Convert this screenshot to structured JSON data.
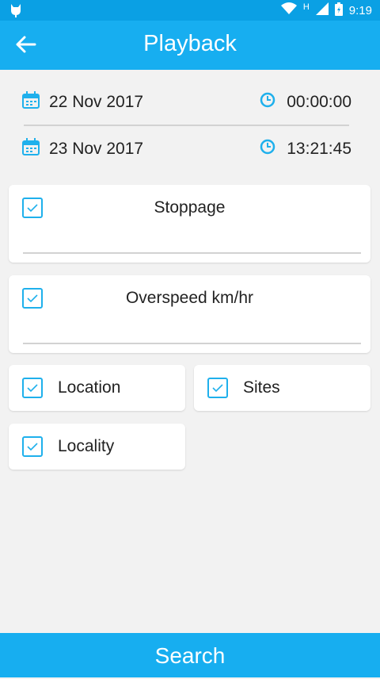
{
  "status_bar": {
    "network": "H",
    "time": "9:19"
  },
  "header": {
    "title": "Playback"
  },
  "from": {
    "date": "22 Nov 2017",
    "time": "00:00:00"
  },
  "to": {
    "date": "23 Nov 2017",
    "time": "13:21:45"
  },
  "filters": {
    "stoppage": {
      "label": "Stoppage",
      "checked": true,
      "value": ""
    },
    "overspeed": {
      "label": "Overspeed km/hr",
      "checked": true,
      "value": ""
    },
    "location": {
      "label": "Location",
      "checked": true
    },
    "sites": {
      "label": "Sites",
      "checked": true
    },
    "locality": {
      "label": "Locality",
      "checked": true
    }
  },
  "search_label": "Search",
  "colors": {
    "header": "#17aef0",
    "status_bar": "#0aa0e4",
    "accent": "#1fb0ec",
    "background": "#f2f2f2"
  },
  "icons": [
    "cat-icon",
    "wifi-icon",
    "signal-icon",
    "battery-icon",
    "back-arrow-icon",
    "calendar-icon",
    "clock-icon",
    "checkbox-checked-icon"
  ]
}
